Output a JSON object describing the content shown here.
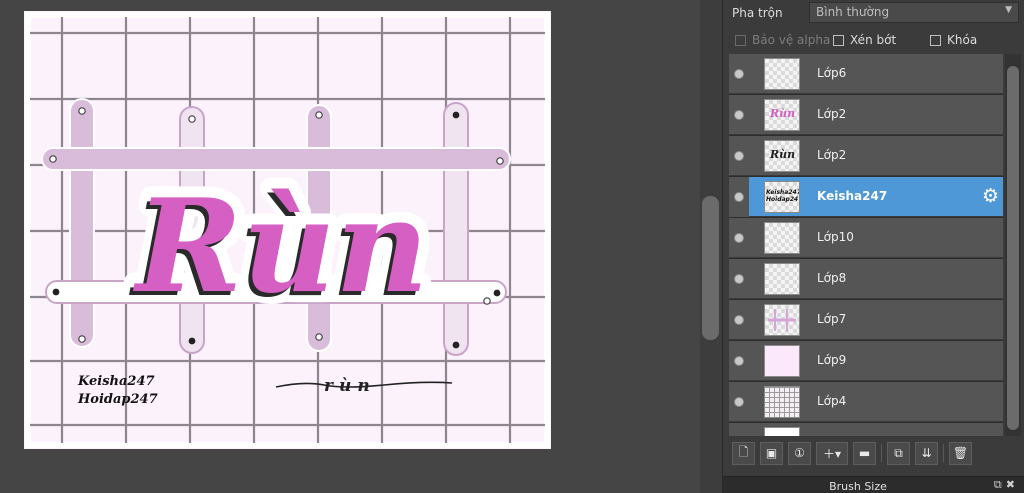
{
  "artboard": {
    "title_text": "Rùn",
    "signature_text": "rùn",
    "credit_lines": [
      "Keisha247",
      "Hoidap247"
    ],
    "colors": {
      "background": "#fcf2fc",
      "grid_lines": "#8e8590",
      "bands": "#d9bcd9",
      "lettering": "#d65fc4",
      "lettering_shadow": "#2a2a2a"
    }
  },
  "panel": {
    "blend_label": "Pha trộn",
    "blend_value": "Bình thường",
    "options": [
      {
        "label": "Bảo vệ alpha",
        "checked": false,
        "disabled": true
      },
      {
        "label": "Xén bớt",
        "checked": false,
        "disabled": false
      },
      {
        "label": "Khóa",
        "checked": false,
        "disabled": false
      }
    ],
    "layers": [
      {
        "name": "Lớp6",
        "thumb": "empty",
        "visible": true,
        "selected": false
      },
      {
        "name": "Lớp2",
        "thumb": "pink-text",
        "thumb_text": "Rùn",
        "visible": true,
        "selected": false
      },
      {
        "name": "Lớp2",
        "thumb": "black-text",
        "thumb_text": "Rùn",
        "visible": true,
        "selected": false
      },
      {
        "name": "Keisha247",
        "thumb": "credit-text",
        "thumb_text": "Keisha247 Hoidap247",
        "visible": true,
        "selected": true
      },
      {
        "name": "Lớp10",
        "thumb": "empty",
        "visible": true,
        "selected": false
      },
      {
        "name": "Lớp8",
        "thumb": "empty",
        "visible": true,
        "selected": false
      },
      {
        "name": "Lớp7",
        "thumb": "lines",
        "visible": true,
        "selected": false
      },
      {
        "name": "Lớp9",
        "thumb": "solid",
        "visible": true,
        "selected": false
      },
      {
        "name": "Lớp4",
        "thumb": "grid",
        "visible": true,
        "selected": false
      }
    ],
    "toolbar_icons": [
      "new-layer-icon",
      "new-bitmap-layer-icon",
      "new-1bit-layer-icon",
      "add-layer-menu-icon",
      "folder-icon",
      "duplicate-icon",
      "merge-icon",
      "delete-icon"
    ],
    "brush_size_title": "Brush Size"
  }
}
